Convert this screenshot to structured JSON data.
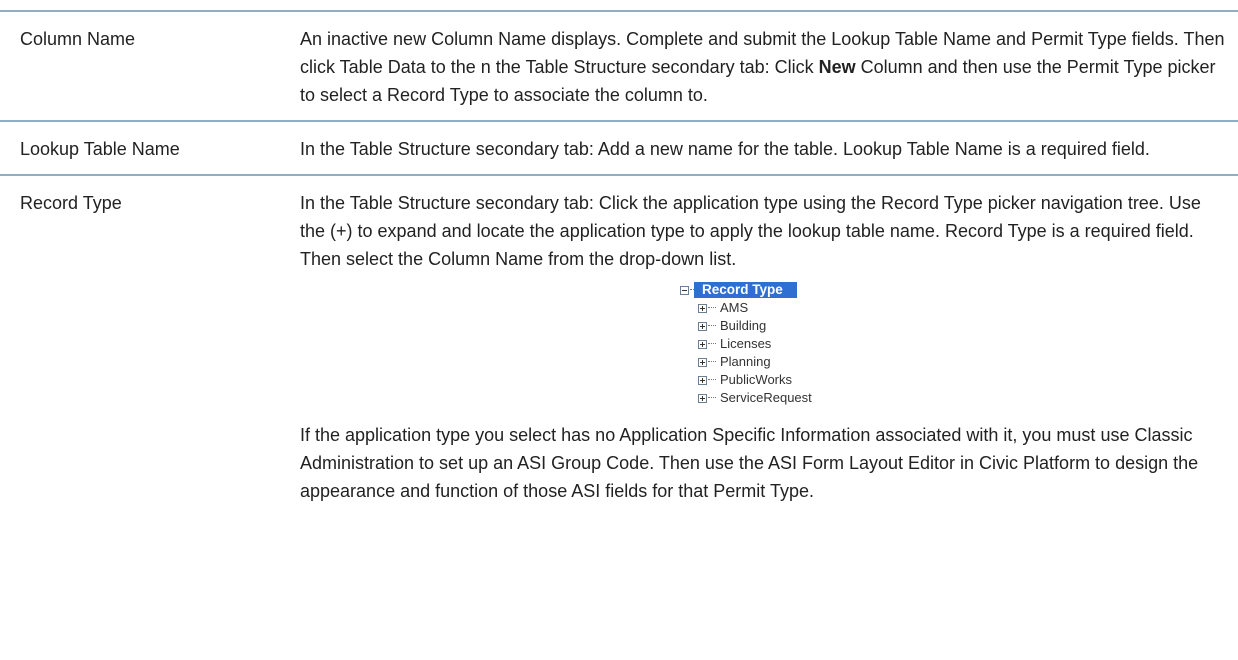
{
  "rows": [
    {
      "term": "Column Name",
      "desc_html_parts": {
        "before": "An inactive new Column Name displays. Complete and submit the Lookup Table Name and Permit Type fields. Then click Table Data to the n the Table Structure secondary tab: Click ",
        "bold": "New",
        "after": " Column and then use the Permit Type picker to select a Record Type to associate the column to."
      }
    },
    {
      "term": "Lookup Table Name",
      "desc": "In the Table Structure secondary tab: Add a new name for the table. Lookup Table Name is a required field."
    },
    {
      "term": "Record Type",
      "desc": "In the Table Structure secondary tab: Click the application type using the Record Type picker navigation tree. Use the (+) to expand and locate the application type to apply the lookup table name. Record Type is a required field. Then select the Column Name from the drop-down list.",
      "tree": {
        "root": "Record Type",
        "items": [
          "AMS",
          "Building",
          "Licenses",
          "Planning",
          "PublicWorks",
          "ServiceRequest"
        ]
      },
      "desc2": "If the application type you select has no Application Specific Information associated with it, you must use Classic Administration to set up an ASI Group Code. Then use the ASI Form Layout Editor in Civic Platform to design the appearance and function of those ASI fields for that Permit Type."
    }
  ]
}
